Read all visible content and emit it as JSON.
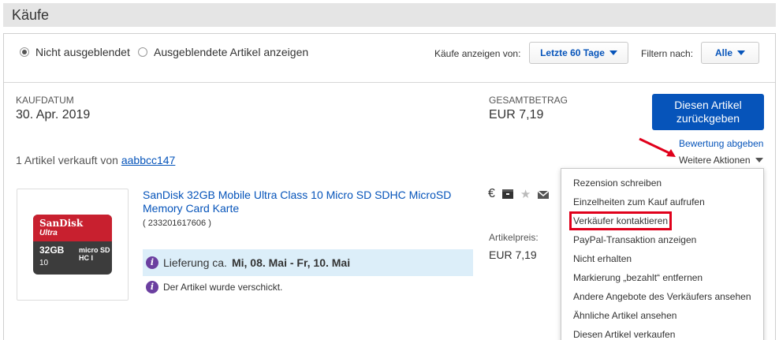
{
  "header": {
    "title": "Käufe"
  },
  "filters": {
    "radio_hidden_off": "Nicht ausgeblendet",
    "radio_hidden_on": "Ausgeblendete Artikel anzeigen",
    "period_label": "Käufe anzeigen von:",
    "period_value": "Letzte 60 Tage",
    "filter_label": "Filtern nach:",
    "filter_value": "Alle"
  },
  "order": {
    "date_label": "KAUFDATUM",
    "date_value": "30. Apr. 2019",
    "total_label": "GESAMTBETRAG",
    "total_value": "EUR 7,19",
    "return_button": "Diesen Artikel zurückgeben",
    "review_link": "Bewertung abgeben",
    "more_actions": "Weitere Aktionen",
    "seller_prefix": "1 Artikel verkauft von",
    "seller_name": "aabbcc147"
  },
  "item": {
    "title": "SanDisk 32GB Mobile Ultra Class 10 Micro SD SDHC MicroSD Memory Card Karte",
    "id": "( 233201617606 )",
    "delivery_prefix": "Lieferung ca.",
    "delivery_dates": "Mi, 08. Mai - Fr, 10. Mai",
    "shipped_status": "Der Artikel wurde verschickt.",
    "price_label": "Artikelpreis:",
    "price_value": "EUR 7,19",
    "image_text": {
      "brand": "SanDisk",
      "line": "Ultra",
      "capacity": "32GB",
      "micro": "micro SD HC I",
      "class": "10"
    }
  },
  "menu": {
    "items": [
      "Rezension schreiben",
      "Einzelheiten zum Kauf aufrufen",
      "Verkäufer kontaktieren",
      "PayPal-Transaktion anzeigen",
      "Nicht erhalten",
      "Markierung „bezahlt“ entfernen",
      "Andere Angebote des Verkäufers ansehen",
      "Ähnliche Artikel ansehen",
      "Diesen Artikel verkaufen"
    ],
    "highlighted_index": 2
  },
  "colors": {
    "link": "#0654ba",
    "button": "#0654ba",
    "highlight": "#e0001b",
    "delivery_bg": "#dceef9",
    "header_bg": "#e5e5e5"
  },
  "icons": [
    "euro-icon",
    "package-icon",
    "star-icon",
    "envelope-icon",
    "info-icon",
    "caret-down-icon",
    "red-arrow-icon"
  ]
}
